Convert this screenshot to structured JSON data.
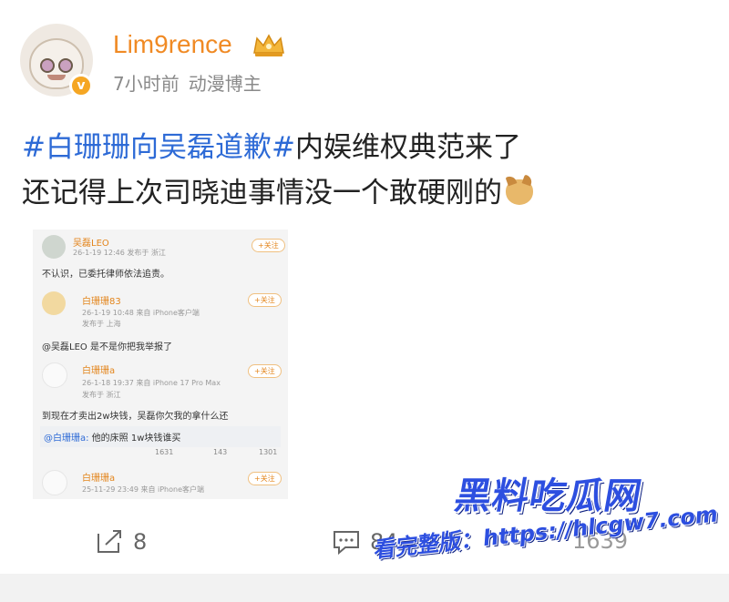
{
  "post": {
    "username": "Lim9rence",
    "time": "7小时前",
    "tag": "动漫博主",
    "topic": "#白珊珊向吴磊道歉#",
    "line1_rest": "内娱维权典范来了",
    "line2": "还记得上次司晓迪事情没一个敢硬刚的"
  },
  "screenshot": {
    "c1": {
      "name": "吴磊LEO",
      "meta": "26-1-19 12:46 发布于 浙江",
      "follow": "+关注",
      "text": "不认识，已委托律师依法追责。"
    },
    "c2": {
      "name": "白珊珊83",
      "meta1": "26-1-19 10:48 来自 iPhone客户端",
      "meta2": "发布于 上海",
      "follow": "+关注",
      "text": "@吴磊LEO 是不是你把我举报了"
    },
    "c3": {
      "name": "白珊珊a",
      "meta1": "26-1-18 19:37 来自 iPhone 17 Pro Max",
      "meta2": "发布于 浙江",
      "follow": "+关注",
      "text": "到现在才卖出2w块钱，吴磊你欠我的拿什么还",
      "reply_at": "@白珊珊a:",
      "reply_text": " 他的床照 1w块钱谁买"
    },
    "stats": {
      "shares": "1631",
      "comments": "143",
      "likes": "1301"
    },
    "c4": {
      "name": "白珊珊a",
      "meta": "25-11-29 23:49 来自 iPhone客户端",
      "follow": "+关注"
    }
  },
  "actions": {
    "repost": "8",
    "comment": "84",
    "like": "1639"
  },
  "watermark": {
    "title": "黑料吃瓜网",
    "url": "看完整版：https://hlcgw7.com"
  },
  "colors": {
    "username": "#f08a24",
    "topic": "#2d6ad6",
    "watermark": "#2d4fe0"
  }
}
